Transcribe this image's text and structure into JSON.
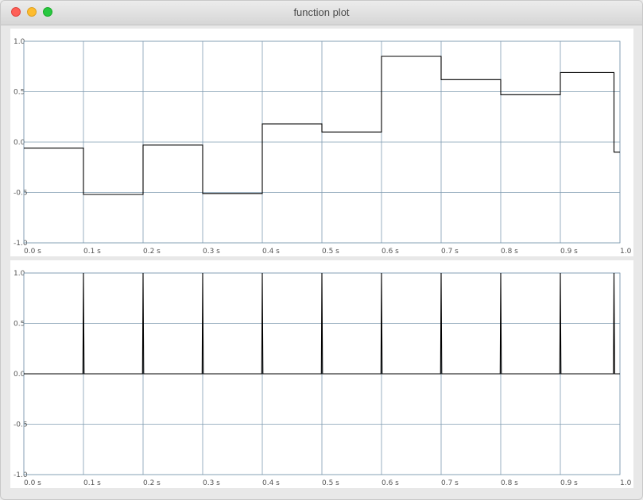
{
  "window": {
    "title": "function plot"
  },
  "chart_data": [
    {
      "type": "line",
      "step": true,
      "xlim": [
        0,
        1
      ],
      "ylim": [
        -1,
        1
      ],
      "grid": true,
      "xticks": [
        "0.0 s",
        "0.1 s",
        "0.2 s",
        "0.3 s",
        "0.4 s",
        "0.5 s",
        "0.6 s",
        "0.7 s",
        "0.8 s",
        "0.9 s",
        "1.0"
      ],
      "yticks": [
        "1.0",
        "0.5",
        "0.0",
        "-0.5",
        "-1.0"
      ],
      "series": [
        {
          "x": [
            0.0,
            0.1,
            0.2,
            0.3,
            0.4,
            0.5,
            0.6,
            0.7,
            0.8,
            0.9,
            0.99
          ],
          "y": [
            -0.06,
            -0.52,
            -0.03,
            -0.51,
            0.18,
            0.1,
            0.85,
            0.62,
            0.47,
            0.69,
            -0.1
          ]
        }
      ]
    },
    {
      "type": "line",
      "xlim": [
        0,
        1
      ],
      "ylim": [
        -1,
        1
      ],
      "grid": true,
      "xticks": [
        "0.0 s",
        "0.1 s",
        "0.2 s",
        "0.3 s",
        "0.4 s",
        "0.5 s",
        "0.6 s",
        "0.7 s",
        "0.8 s",
        "0.9 s",
        "1.0"
      ],
      "yticks": [
        "1.0",
        "0.5",
        "0.0",
        "-0.5",
        "-1.0"
      ],
      "series": [
        {
          "x": [
            0,
            0.099,
            0.1,
            0.101,
            0.199,
            0.2,
            0.201,
            0.299,
            0.3,
            0.301,
            0.399,
            0.4,
            0.401,
            0.499,
            0.5,
            0.501,
            0.599,
            0.6,
            0.601,
            0.699,
            0.7,
            0.701,
            0.799,
            0.8,
            0.801,
            0.899,
            0.9,
            0.901,
            0.989,
            0.99,
            0.991,
            1.0
          ],
          "y": [
            0,
            0,
            1,
            0,
            0,
            1,
            0,
            0,
            1,
            0,
            0,
            1,
            0,
            0,
            1,
            0,
            0,
            1,
            0,
            0,
            1,
            0,
            0,
            1,
            0,
            0,
            1,
            0,
            0,
            1,
            0,
            0
          ]
        }
      ]
    }
  ]
}
